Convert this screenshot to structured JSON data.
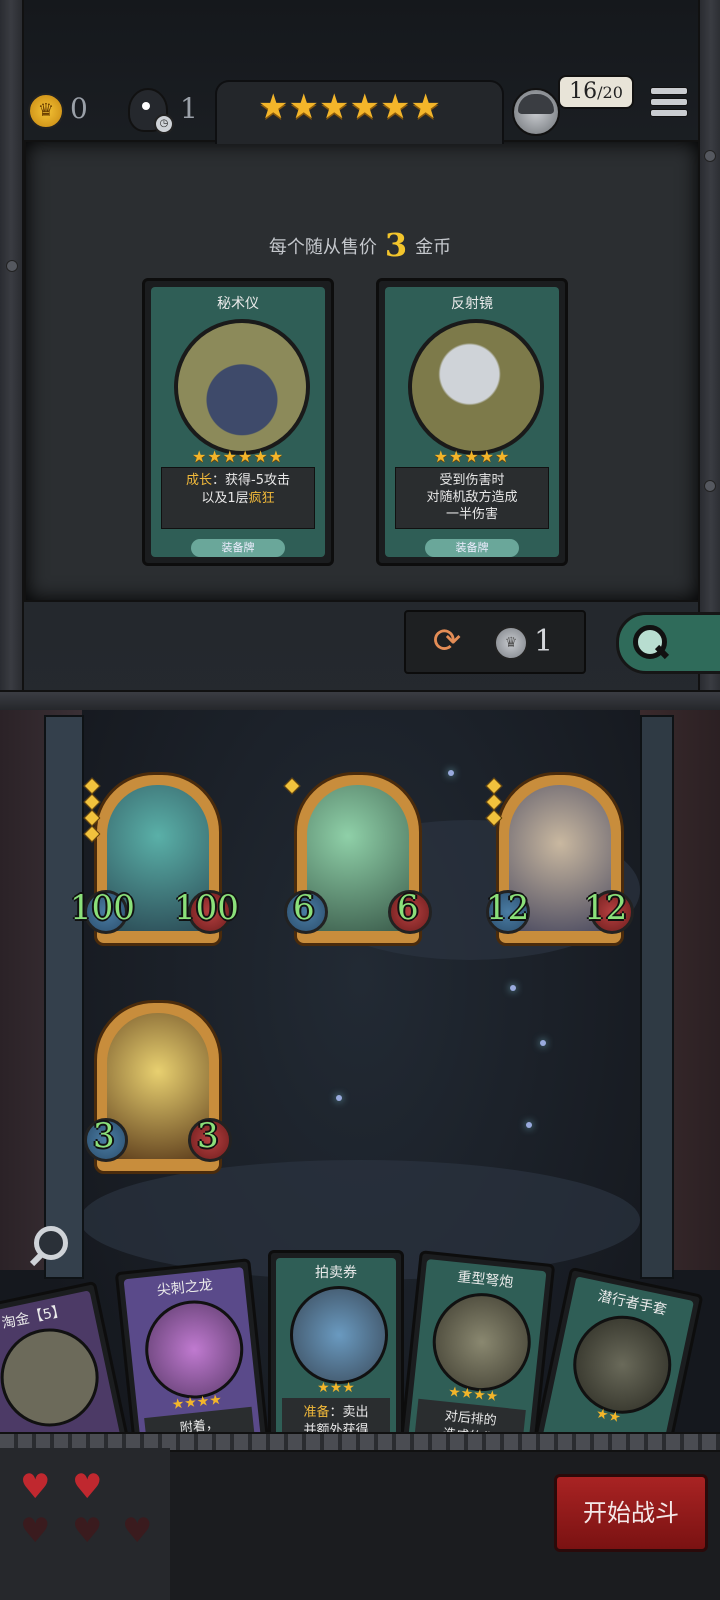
{
  "topbar": {
    "gold": "0",
    "crow_count": "1",
    "shop_tier_stars": 6,
    "turn_current": "16",
    "turn_max": "/20",
    "icons": {
      "gold": "coin-icon",
      "crow": "crow-clock-icon",
      "menu": "hamburger-menu-icon",
      "avatar": "player-avatar-icon"
    }
  },
  "shop": {
    "price_prefix": "每个随从售价",
    "price_value": "3",
    "price_suffix": "金币",
    "cards": [
      {
        "title": "秘术仪",
        "stars": "★★★★★★",
        "desc_kw": "成长",
        "desc_rest": "：获得-5攻击",
        "desc_line2_pre": "以及1层",
        "desc_line2_kw": "疯狂",
        "type": "装备牌",
        "art_color": "#8c8a5a"
      },
      {
        "title": "反射镜",
        "stars": "★★★★★",
        "desc_line1": "受到伤害时",
        "desc_line2": "对随机敌方造成",
        "desc_line3": "一半伤害",
        "type": "装备牌",
        "art_color": "#7d7a4a"
      }
    ],
    "refresh_cost": "1"
  },
  "board": {
    "minions": [
      {
        "name": "dragon-minion",
        "atk": "100",
        "hp": "100",
        "tier_gems": 4,
        "color": "#3f7d7a"
      },
      {
        "name": "serpent-minion",
        "atk": "6",
        "hp": "6",
        "tier_gems": 1,
        "color": "#5b8a6a"
      },
      {
        "name": "beast-minion",
        "atk": "12",
        "hp": "12",
        "tier_gems": 3,
        "color": "#6d6f8a"
      },
      {
        "name": "cultist-minion",
        "atk": "3",
        "hp": "3",
        "tier_gems": 0,
        "color": "#8a6a3a"
      }
    ]
  },
  "hand": {
    "cards": [
      {
        "title": "淘金【5】",
        "frame": "#4c3a66",
        "art": "#6c6a5a",
        "stars": "",
        "desc_kw": "",
        "desc": ""
      },
      {
        "title": "尖刺之龙",
        "frame": "#5a4a8a",
        "art": "#9a6aa8",
        "stars": "★★★★",
        "desc_kw": "",
        "desc": "附着，"
      },
      {
        "title": "拍卖券",
        "frame": "#2f5e56",
        "art": "#4a7a9a",
        "stars": "★★★",
        "desc_kw": "准备",
        "desc": "：卖出",
        "desc2": "并额外获得"
      },
      {
        "title": "重型弩炮",
        "frame": "#2f5e56",
        "art": "#5c5a4a",
        "stars": "★★★★",
        "desc_kw": "",
        "desc": "对后排的",
        "desc2": "造成的伤"
      },
      {
        "title": "潜行者手套",
        "frame": "#2f5e56",
        "art": "#4a4a3a",
        "stars": "★★",
        "desc_kw": "",
        "desc": "",
        "desc2": ""
      }
    ]
  },
  "lives": {
    "filled": 2,
    "total": 5
  },
  "start_button": "开始战斗",
  "colors": {
    "gold": "#f3b52a",
    "accent_green": "#2f5e56",
    "heal_red": "#b54040",
    "stat_green": "#8be07a"
  }
}
